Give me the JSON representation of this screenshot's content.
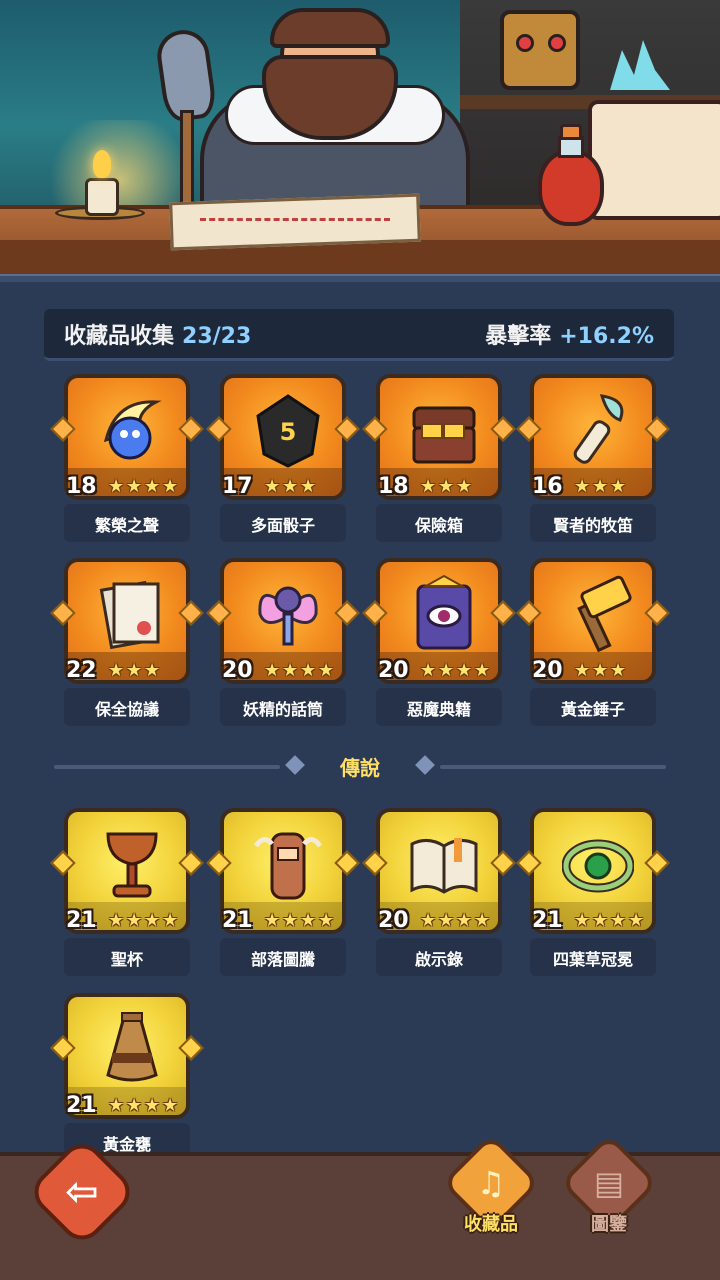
{
  "collection": {
    "title": "收藏品收集",
    "count": "23/23",
    "crit_label": "暴擊率",
    "crit_value": "+16.2%"
  },
  "legend_section": {
    "title": "傳說"
  },
  "items": [
    {
      "name": "繁榮之聲",
      "level": "18",
      "stars": 4,
      "rarity": "epic",
      "icon": "blue-orb-icon"
    },
    {
      "name": "多面骰子",
      "level": "17",
      "stars": 3,
      "rarity": "epic",
      "icon": "dice-icon"
    },
    {
      "name": "保險箱",
      "level": "18",
      "stars": 3,
      "rarity": "epic",
      "icon": "gold-chest-icon"
    },
    {
      "name": "賢者的牧笛",
      "level": "16",
      "stars": 3,
      "rarity": "epic",
      "icon": "pipe-icon"
    },
    {
      "name": "保全協議",
      "level": "22",
      "stars": 3,
      "rarity": "epic",
      "icon": "scroll-icon"
    },
    {
      "name": "妖精的話筒",
      "level": "20",
      "stars": 4,
      "rarity": "epic",
      "icon": "fairy-mic-icon"
    },
    {
      "name": "惡魔典籍",
      "level": "20",
      "stars": 4,
      "rarity": "epic",
      "icon": "demon-book-icon"
    },
    {
      "name": "黃金錘子",
      "level": "20",
      "stars": 3,
      "rarity": "epic",
      "icon": "hammer-icon"
    },
    {
      "name": "聖杯",
      "level": "21",
      "stars": 4,
      "rarity": "legend",
      "icon": "chalice-icon"
    },
    {
      "name": "部落圖騰",
      "level": "21",
      "stars": 4,
      "rarity": "legend",
      "icon": "totem-icon"
    },
    {
      "name": "啟示錄",
      "level": "20",
      "stars": 4,
      "rarity": "legend",
      "icon": "open-book-icon"
    },
    {
      "name": "四葉草冠冕",
      "level": "21",
      "stars": 4,
      "rarity": "legend",
      "icon": "clover-crown-icon"
    },
    {
      "name": "黃金甕",
      "level": "21",
      "stars": 4,
      "rarity": "legend",
      "icon": "golden-urn-icon"
    }
  ],
  "nav": {
    "back_icon": "back-arrow-icon",
    "tabs": [
      {
        "label": "收藏品",
        "icon": "lyre-icon",
        "active": true
      },
      {
        "label": "圖鑒",
        "icon": "book-icon",
        "active": false
      }
    ]
  },
  "colors": {
    "epic": "#f28a1e",
    "legend": "#f2d23a",
    "crit_value": "#8fd0ff",
    "legend_title": "#ffe066"
  }
}
